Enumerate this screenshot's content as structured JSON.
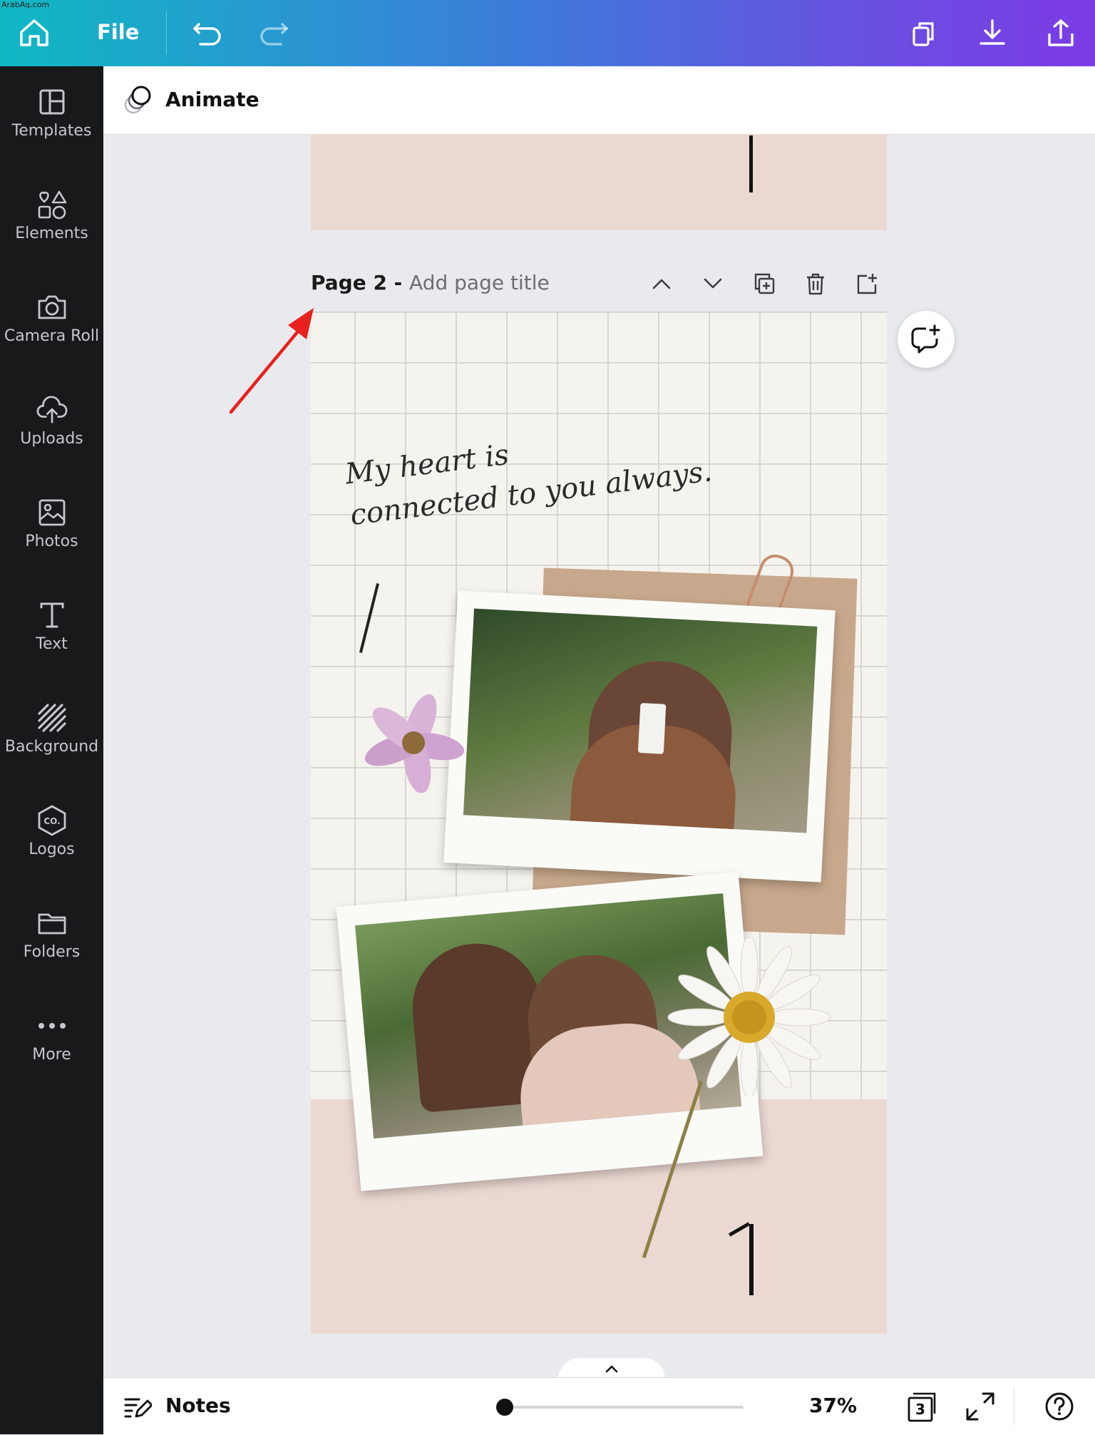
{
  "watermark": "ArabAq.com",
  "topbar": {
    "file_label": "File",
    "icons": [
      "home-icon",
      "undo-icon",
      "redo-icon",
      "duplicate-icon",
      "download-icon",
      "share-icon"
    ]
  },
  "sidebar": {
    "items": [
      {
        "label": "Templates",
        "icon": "templates-icon"
      },
      {
        "label": "Elements",
        "icon": "elements-icon"
      },
      {
        "label": "Camera Roll",
        "icon": "camera-icon"
      },
      {
        "label": "Uploads",
        "icon": "upload-icon"
      },
      {
        "label": "Photos",
        "icon": "photo-icon"
      },
      {
        "label": "Text",
        "icon": "text-icon"
      },
      {
        "label": "Background",
        "icon": "background-icon"
      },
      {
        "label": "Logos",
        "icon": "logo-icon"
      },
      {
        "label": "Folders",
        "icon": "folder-icon"
      },
      {
        "label": "More",
        "icon": "more-icon"
      }
    ]
  },
  "animate": {
    "label": "Animate"
  },
  "page2": {
    "title": "Page 2 - ",
    "subtitle": "Add page title",
    "script_line1": "My heart is",
    "script_line2": "connected to you always."
  },
  "bottom": {
    "notes_label": "Notes",
    "zoom": "37%",
    "zoom_fraction": 0.0,
    "page_count": "3"
  },
  "colors": {
    "gradient_start": "#10b8c4",
    "gradient_end": "#7c3be6",
    "sidebar_bg": "#18191b",
    "arrow": "#e8211e"
  }
}
